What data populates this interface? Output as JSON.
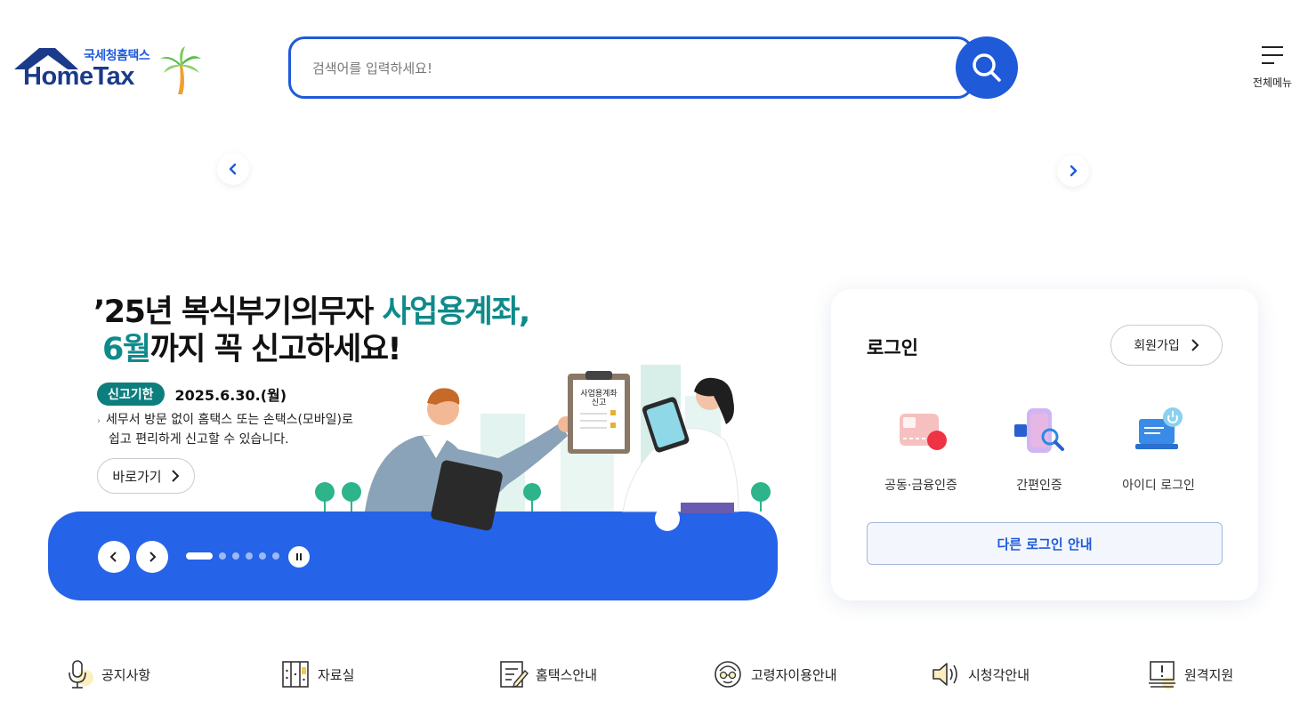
{
  "header": {
    "logo_sub": "국세청홈택스",
    "logo_main": "HomeTax",
    "search_placeholder": "검색어를 입력하세요!",
    "all_menu_label": "전체메뉴"
  },
  "banner": {
    "title_line1_pre": "’25년 복식부기의무자 ",
    "title_line1_accent": "사업용계좌,",
    "title_line2_accent": "6월",
    "title_line2_post": "까지 꼭 신고하세요!",
    "deadline_badge": "신고기한",
    "deadline_date": "2025.6.30.(월)",
    "desc_line1": "세무서 방문 없이 홈택스 또는 손택스(모바일)로",
    "desc_line2": "쉽고 편리하게 신고할 수 있습니다.",
    "go_button": "바로가기",
    "clipboard_text_1": "사업용계좌",
    "clipboard_text_2": "신고",
    "slide_count": 6,
    "active_slide": 1
  },
  "login": {
    "title": "로그인",
    "join_button": "회원가입",
    "options": [
      {
        "label": "공동·금융인증",
        "icon": "certificate-card-icon"
      },
      {
        "label": "간편인증",
        "icon": "simple-auth-phone-icon"
      },
      {
        "label": "아이디 로그인",
        "icon": "id-login-laptop-icon"
      }
    ],
    "other_login_button": "다른 로그인 안내"
  },
  "quick_menu": [
    {
      "label": "공지사항",
      "icon": "microphone-icon"
    },
    {
      "label": "자료실",
      "icon": "archive-cabinet-icon"
    },
    {
      "label": "홈택스안내",
      "icon": "guide-document-icon"
    },
    {
      "label": "고령자이용안내",
      "icon": "senior-face-icon"
    },
    {
      "label": "시청각안내",
      "icon": "speaker-icon"
    },
    {
      "label": "원격지원",
      "icon": "remote-support-monitor-icon"
    }
  ],
  "colors": {
    "brand_blue": "#1f5ad8",
    "banner_blue": "#2563e8",
    "teal_accent": "#0f8a8a"
  }
}
